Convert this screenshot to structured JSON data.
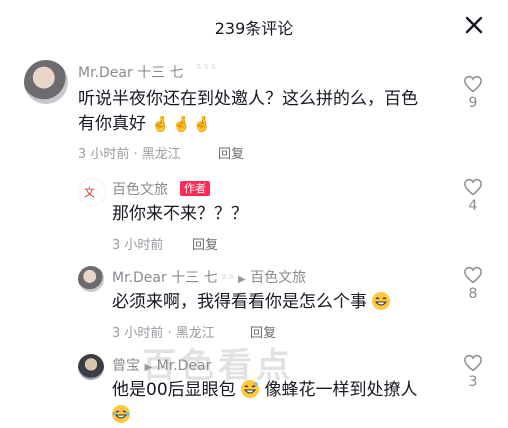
{
  "header": {
    "title": "239条评论",
    "close_icon": "close-icon"
  },
  "comments": [
    {
      "user": "Mr.Dear 十三 七",
      "text_line1": "听说半夜你还在到处邀人？这么拼的么，百色",
      "text_line2": "有你真好",
      "emoji": [
        "crossed-fingers-emoji",
        "crossed-fingers-emoji",
        "crossed-fingers-emoji"
      ],
      "time_location": "3 小时前 · 黑龙江",
      "reply_label": "回复",
      "likes": "9"
    },
    {
      "user": "百色文旅",
      "badge": "作者",
      "text": "那你来不来？？？",
      "time": "3 小时前",
      "reply_label": "回复",
      "likes": "4"
    },
    {
      "user": "Mr.Dear 十三 七",
      "reply_to": "百色文旅",
      "text": "必须来啊，我得看看你是怎么个事",
      "time_location": "3 小时前 · 黑龙江",
      "reply_label": "回复",
      "likes": "8"
    },
    {
      "user": "曾宝",
      "reply_to": "Mr.Dear",
      "text_part1": "他是00后显眼包",
      "text_part2": "像蜂花一样到处撩人",
      "likes": "3"
    }
  ],
  "watermark": "百色看点",
  "colors": {
    "author_badge": "#fe2c55",
    "meta": "#9a9ba1",
    "text": "#161823"
  }
}
